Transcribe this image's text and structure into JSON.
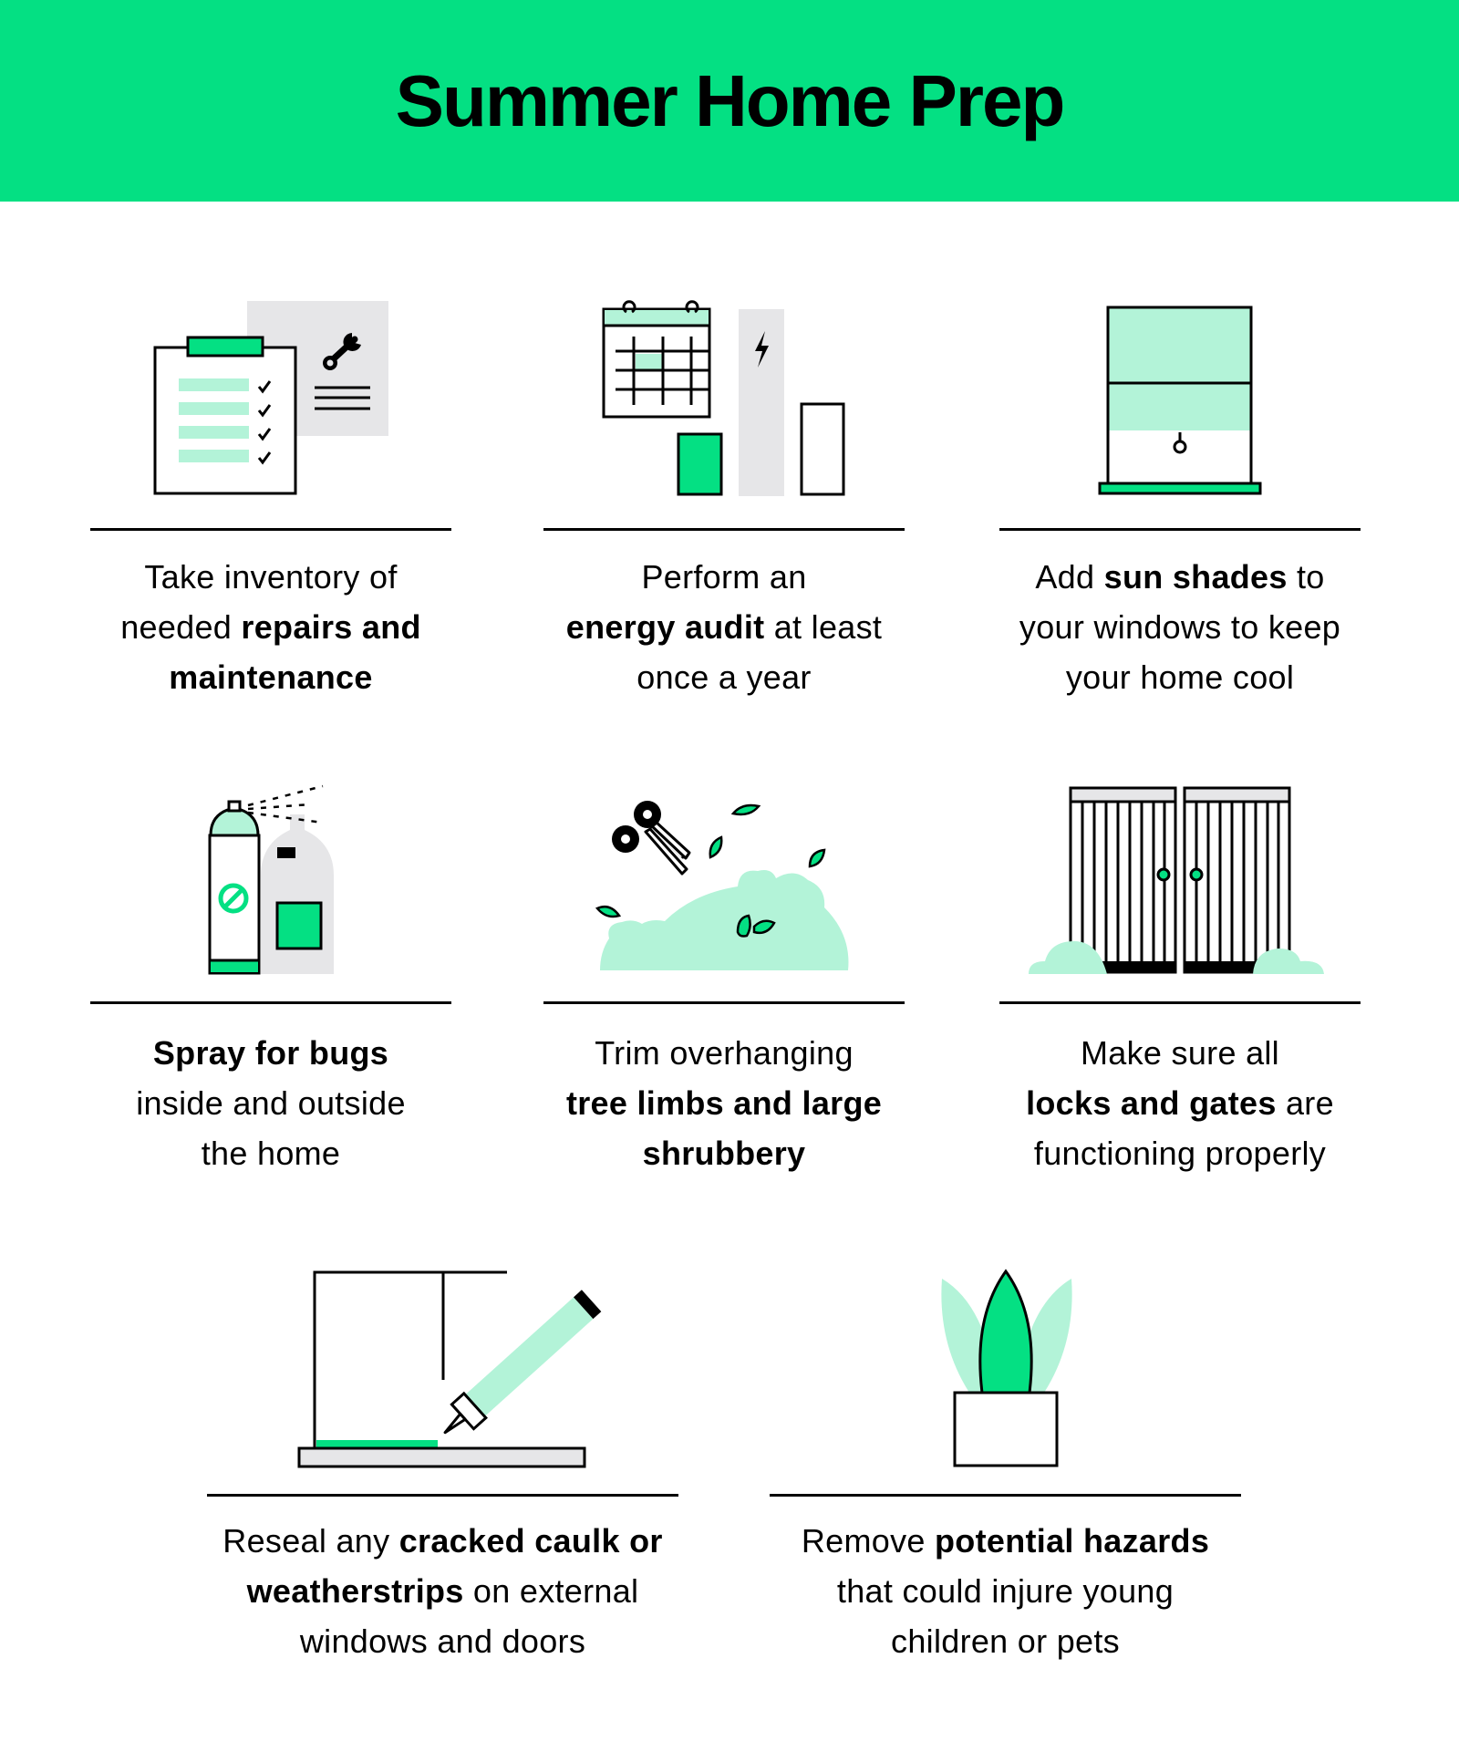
{
  "title": "Summer Home Prep",
  "colors": {
    "brand_green": "#04E083",
    "light_green": "#B3F3D8",
    "light_gray": "#E6E6E8",
    "text": "#000000"
  },
  "tips": [
    {
      "icon": "clipboard-checklist-wrench-icon",
      "lines": [
        [
          {
            "t": "Take inventory of",
            "b": false
          }
        ],
        [
          {
            "t": "needed ",
            "b": false
          },
          {
            "t": "repairs and",
            "b": true
          }
        ],
        [
          {
            "t": "maintenance",
            "b": true
          }
        ]
      ]
    },
    {
      "icon": "calendar-energy-meter-icon",
      "lines": [
        [
          {
            "t": "Perform an",
            "b": false
          }
        ],
        [
          {
            "t": "energy audit",
            "b": true
          },
          {
            "t": " at least",
            "b": false
          }
        ],
        [
          {
            "t": "once a year",
            "b": false
          }
        ]
      ]
    },
    {
      "icon": "window-shade-icon",
      "lines": [
        [
          {
            "t": "Add ",
            "b": false
          },
          {
            "t": "sun shades",
            "b": true
          },
          {
            "t": " to",
            "b": false
          }
        ],
        [
          {
            "t": "your windows to keep",
            "b": false
          }
        ],
        [
          {
            "t": "your home cool",
            "b": false
          }
        ]
      ]
    },
    {
      "icon": "bug-spray-can-icon",
      "lines": [
        [
          {
            "t": "Spray for bugs",
            "b": true
          }
        ],
        [
          {
            "t": "inside and outside",
            "b": false
          }
        ],
        [
          {
            "t": "the home",
            "b": false
          }
        ]
      ]
    },
    {
      "icon": "pruning-shears-shrub-icon",
      "lines": [
        [
          {
            "t": "Trim overhanging",
            "b": false
          }
        ],
        [
          {
            "t": "tree limbs and large",
            "b": true
          }
        ],
        [
          {
            "t": "shrubbery",
            "b": true
          }
        ]
      ]
    },
    {
      "icon": "locked-gates-icon",
      "lines": [
        [
          {
            "t": "Make sure all",
            "b": false
          }
        ],
        [
          {
            "t": "locks and gates",
            "b": true
          },
          {
            "t": " are",
            "b": false
          }
        ],
        [
          {
            "t": "functioning properly",
            "b": false
          }
        ]
      ]
    },
    {
      "icon": "caulk-gun-window-icon",
      "lines": [
        [
          {
            "t": "Reseal any ",
            "b": false
          },
          {
            "t": "cracked caulk or",
            "b": true
          }
        ],
        [
          {
            "t": "weatherstrips",
            "b": true
          },
          {
            "t": " on external",
            "b": false
          }
        ],
        [
          {
            "t": "windows and doors",
            "b": false
          }
        ]
      ]
    },
    {
      "icon": "potted-plant-icon",
      "lines": [
        [
          {
            "t": "Remove ",
            "b": false
          },
          {
            "t": "potential hazards",
            "b": true
          }
        ],
        [
          {
            "t": "that could injure young",
            "b": false
          }
        ],
        [
          {
            "t": "children or pets",
            "b": false
          }
        ]
      ]
    }
  ]
}
